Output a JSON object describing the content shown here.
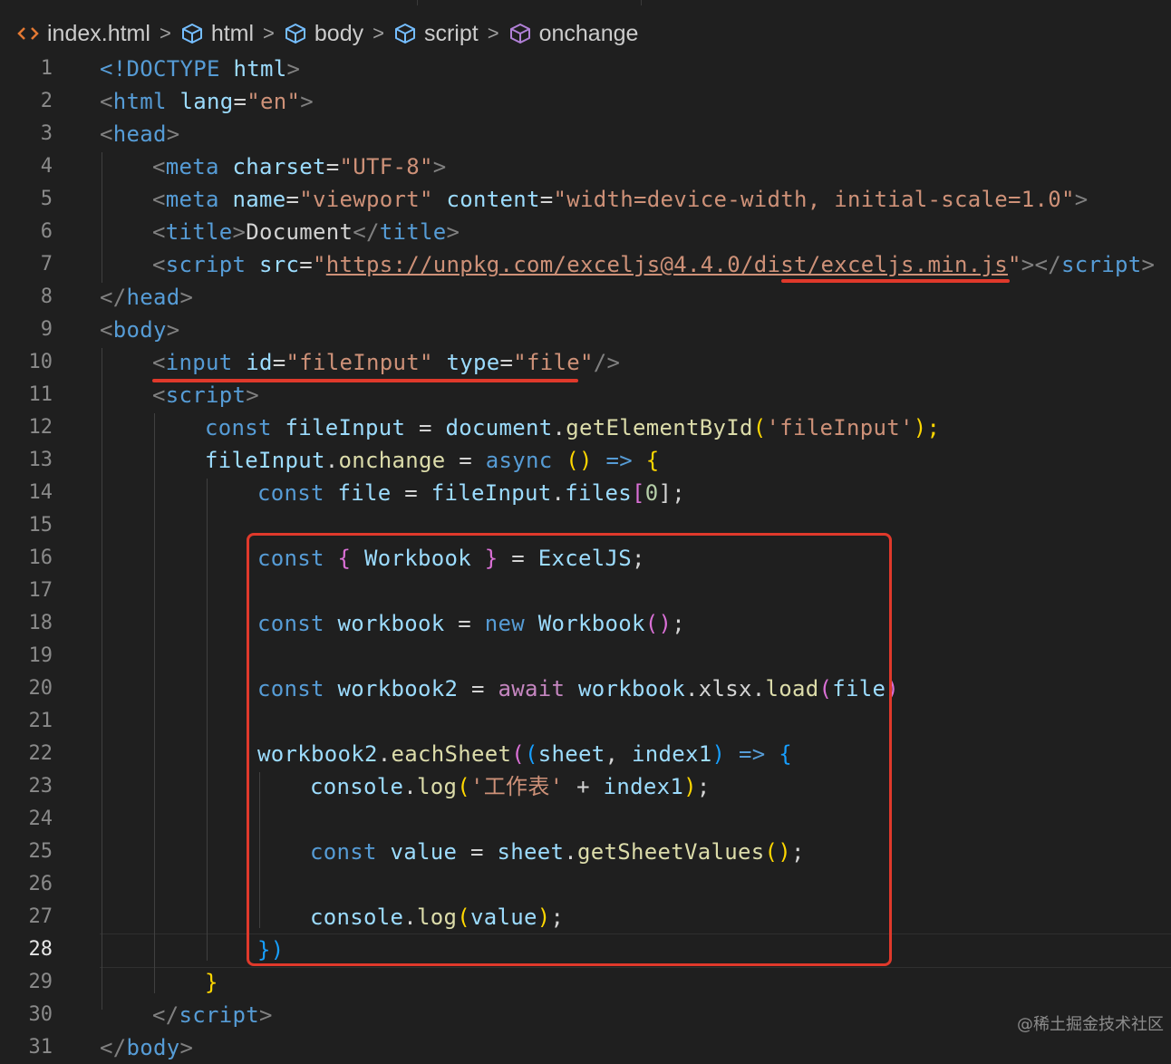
{
  "breadcrumb": {
    "items": [
      {
        "label": "index.html",
        "icon": "html-file-icon"
      },
      {
        "label": "html",
        "icon": "cube-icon"
      },
      {
        "label": "body",
        "icon": "cube-icon"
      },
      {
        "label": "script",
        "icon": "cube-icon"
      },
      {
        "label": "onchange",
        "icon": "cube-icon-purple"
      }
    ],
    "separator": ">"
  },
  "editor": {
    "current_line": 28,
    "line_numbers": [
      "1",
      "2",
      "3",
      "4",
      "5",
      "6",
      "7",
      "8",
      "9",
      "10",
      "11",
      "12",
      "13",
      "14",
      "15",
      "16",
      "17",
      "18",
      "19",
      "20",
      "21",
      "22",
      "23",
      "24",
      "25",
      "26",
      "27",
      "28",
      "29",
      "30",
      "31"
    ],
    "lines": {
      "l1": [
        "<!DOCTYPE",
        " html",
        ">"
      ],
      "l2": [
        "<",
        "html",
        " lang",
        "=",
        "\"en\"",
        ">"
      ],
      "l3": [
        "<",
        "head",
        ">"
      ],
      "l4": [
        "<",
        "meta",
        " charset",
        "=",
        "\"UTF-8\"",
        ">"
      ],
      "l5": [
        "<",
        "meta",
        " name",
        "=",
        "\"viewport\"",
        " content",
        "=",
        "\"width=device-width, initial-scale=1.0\"",
        ">"
      ],
      "l6": [
        "<",
        "title",
        ">",
        "Document",
        "</",
        "title",
        ">"
      ],
      "l7": [
        "<",
        "script",
        " src",
        "=",
        "\"",
        "https://unpkg.com/exceljs@4.4.0/dist/exceljs.min.js",
        "\"",
        "></",
        "script",
        ">"
      ],
      "l8": [
        "</",
        "head",
        ">"
      ],
      "l9": [
        "<",
        "body",
        ">"
      ],
      "l10": [
        "<",
        "input",
        " id",
        "=",
        "\"fileInput\"",
        " type",
        "=",
        "\"file\"",
        "/>"
      ],
      "l11": [
        "<",
        "script",
        ">"
      ],
      "l12": [
        "const",
        " fileInput",
        " = ",
        "document",
        ".",
        "getElementById",
        "(",
        "'fileInput'",
        ");"
      ],
      "l13": [
        "fileInput",
        ".",
        "onchange",
        " = ",
        "async",
        " ",
        "()",
        " => ",
        "{"
      ],
      "l14": [
        "const",
        " file",
        " = ",
        "fileInput",
        ".",
        "files",
        "[",
        "0",
        "];"
      ],
      "l16": [
        "const",
        " ",
        "{",
        " Workbook ",
        "}",
        " = ",
        "ExcelJS",
        ";"
      ],
      "l18": [
        "const",
        " workbook",
        " = ",
        "new",
        " ",
        "Workbook",
        "()",
        ";"
      ],
      "l20": [
        "const",
        " workbook2",
        " = ",
        "await",
        " ",
        "workbook",
        ".",
        "xlsx",
        ".",
        "load",
        "(",
        "file",
        ")"
      ],
      "l22": [
        "workbook2",
        ".",
        "eachSheet",
        "(",
        "(",
        "sheet",
        ", ",
        "index1",
        ")",
        " => ",
        "{"
      ],
      "l23": [
        "console",
        ".",
        "log",
        "(",
        "'工作表'",
        " + ",
        "index1",
        ")",
        ";"
      ],
      "l25": [
        "const",
        " value",
        " = ",
        "sheet",
        ".",
        "getSheetValues",
        "()",
        ";"
      ],
      "l27": [
        "console",
        ".",
        "log",
        "(",
        "value",
        ")",
        ";"
      ],
      "l28": [
        "})",
        ""
      ],
      "l29": [
        "}"
      ],
      "l30": [
        "</",
        "script",
        ">"
      ],
      "l31": [
        "</",
        "body",
        ">"
      ]
    }
  },
  "colors": {
    "background": "#1f1f1f",
    "annotation": "#e0392b"
  },
  "watermark": "@稀土掘金技术社区"
}
